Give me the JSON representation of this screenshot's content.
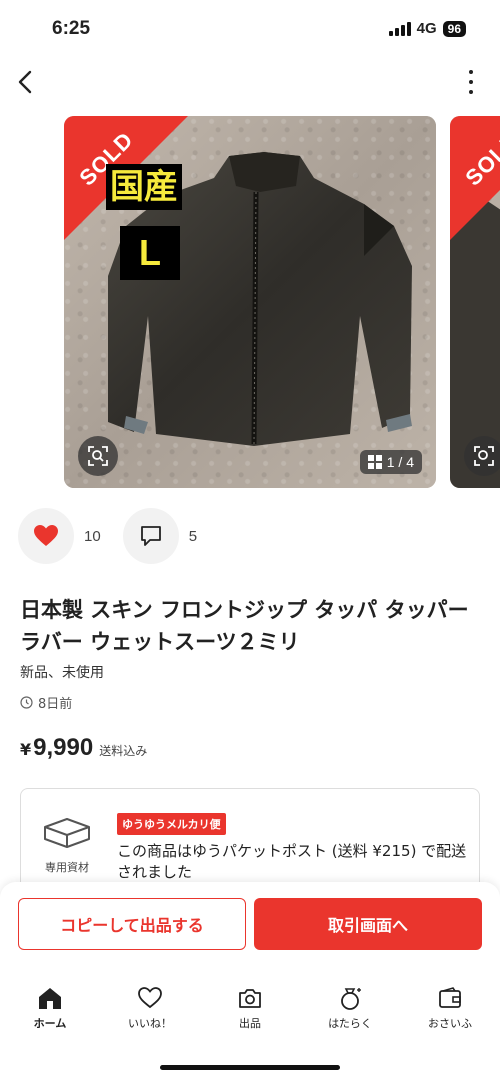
{
  "status_bar": {
    "time": "6:25",
    "network": "4G",
    "battery": "96"
  },
  "gallery": {
    "sold_label": "SOLD",
    "tag_domestic": "国産",
    "tag_size": "L",
    "counter": "1 / 4"
  },
  "engagement": {
    "likes": "10",
    "comments": "5"
  },
  "product": {
    "title": "日本製 スキン フロントジップ タッパ タッパーラバー ウェットスーツ２ミリ",
    "condition": "新品、未使用",
    "posted": "8日前",
    "currency": "¥",
    "price": "9,990",
    "shipping_included": "送料込み"
  },
  "shipping": {
    "box_label": "専用資材",
    "badge": "ゆうゆうメルカリ便",
    "message": "この商品はゆうパケットポスト (送料 ¥215) で配送されました"
  },
  "actions": {
    "copy_label": "コピーして出品する",
    "trade_label": "取引画面へ"
  },
  "tabbar": {
    "items": [
      {
        "label": "ホーム",
        "icon": "home-icon"
      },
      {
        "label": "いいね！",
        "icon": "heart-icon"
      },
      {
        "label": "出品",
        "icon": "camera-icon"
      },
      {
        "label": "はたらく",
        "icon": "bag-icon"
      },
      {
        "label": "おさいふ",
        "icon": "wallet-icon"
      }
    ]
  },
  "colors": {
    "accent": "#ea352d",
    "tag_text": "#f6ea3c"
  }
}
